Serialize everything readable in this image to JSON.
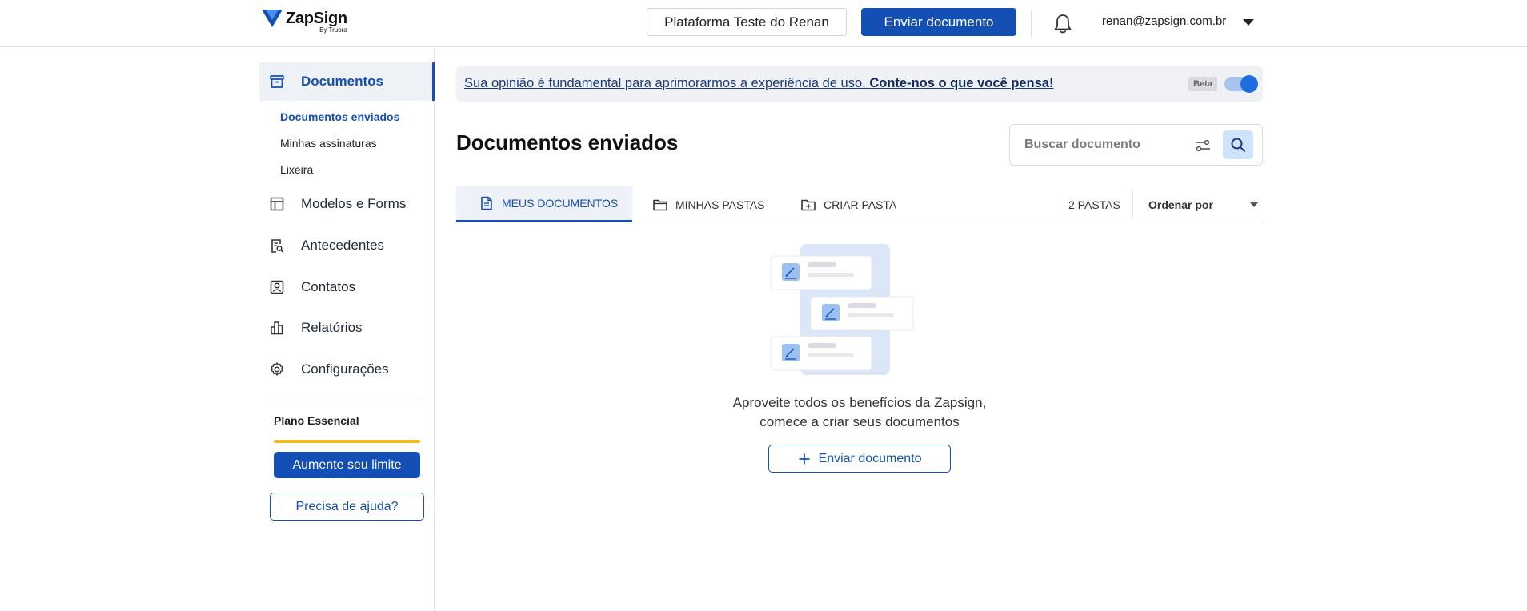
{
  "header": {
    "logo_name": "ZapSign",
    "logo_sub": "By Truora",
    "workspace_label": "Plataforma Teste do Renan",
    "send_label": "Enviar documento",
    "user_email": "renan@zapsign.com.br",
    "bell_icon": "bell-icon",
    "accent_color": "#1450b4"
  },
  "sidebar": {
    "items": [
      {
        "label": "Documentos",
        "icon": "archive-icon",
        "active": true
      },
      {
        "label": "Modelos e Forms",
        "icon": "template-icon"
      },
      {
        "label": "Antecedentes",
        "icon": "document-search-icon"
      },
      {
        "label": "Contatos",
        "icon": "contact-icon"
      },
      {
        "label": "Relatórios",
        "icon": "bar-chart-icon"
      },
      {
        "label": "Configurações",
        "icon": "gear-icon"
      }
    ],
    "subitems": [
      {
        "label": "Documentos enviados",
        "active": true
      },
      {
        "label": "Minhas assinaturas"
      },
      {
        "label": "Lixeira"
      }
    ],
    "plan_label": "Plano Essencial",
    "plan_usage": 1.0,
    "plan_color": "#f5b822",
    "upgrade_label": "Aumente seu limite",
    "help_label": "Precisa de ajuda?"
  },
  "banner": {
    "text": "Sua opinião é fundamental para aprimorarmos a experiência de uso.",
    "link": "Conte-nos o que você pensa!",
    "beta_label": "Beta",
    "toggle_on": true
  },
  "main": {
    "title": "Documentos enviados",
    "search_placeholder": "Buscar documento",
    "tabs": [
      {
        "label": "MEUS DOCUMENTOS",
        "icon": "document-icon",
        "active": true
      },
      {
        "label": "MINHAS PASTAS",
        "icon": "folder-icon"
      },
      {
        "label": "CRIAR PASTA",
        "icon": "folder-plus-icon"
      }
    ],
    "folders_count": "2 PASTAS",
    "sort_label": "Ordenar por",
    "empty_line1": "Aproveite todos os benefícios da Zapsign,",
    "empty_line2": "comece a criar seus documentos",
    "empty_button": "Enviar documento"
  }
}
